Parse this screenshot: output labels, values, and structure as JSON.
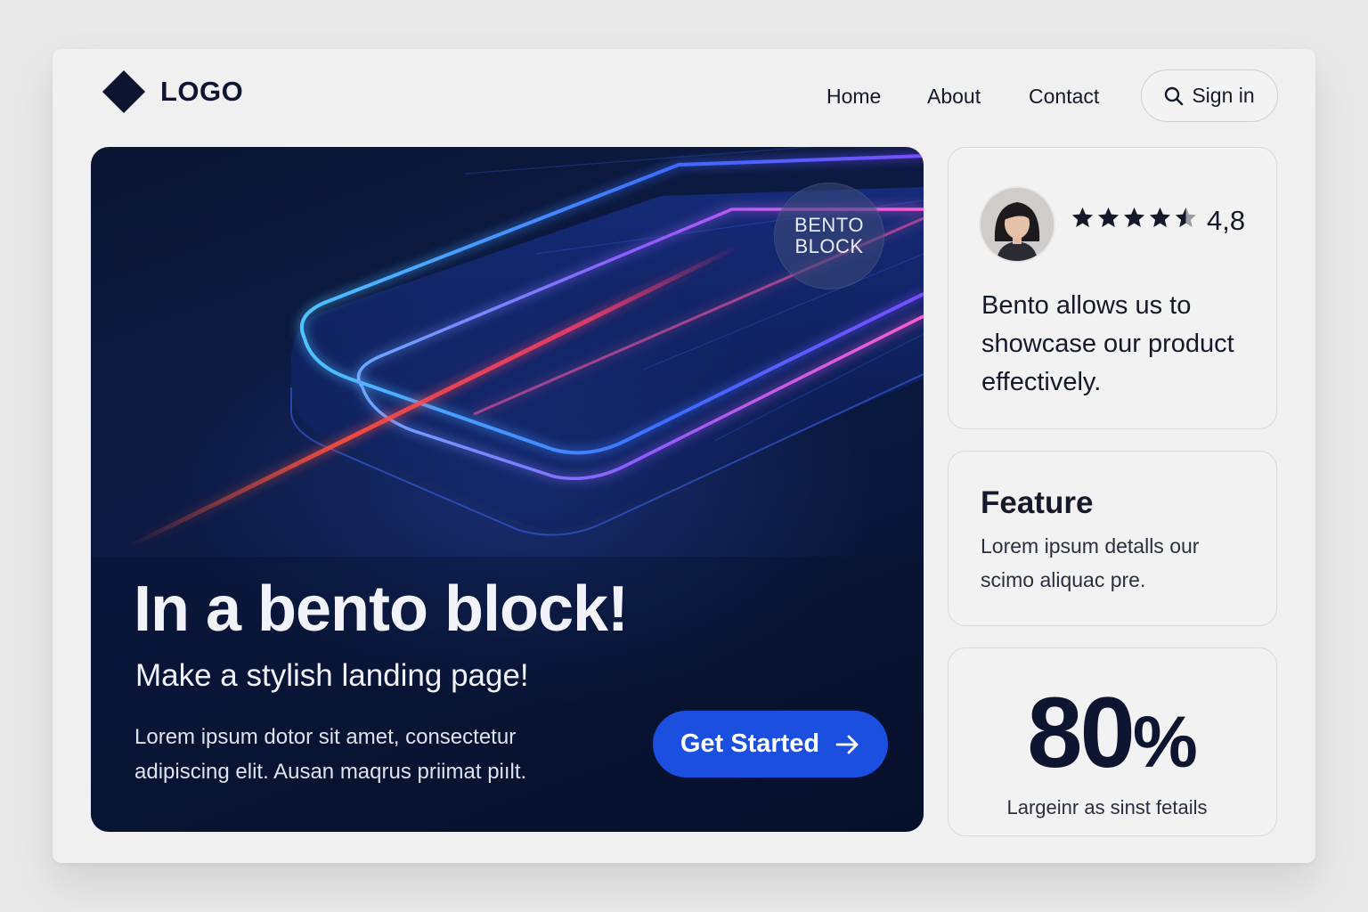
{
  "header": {
    "logo": "LOGO",
    "nav": [
      {
        "label": "Home"
      },
      {
        "label": "About"
      },
      {
        "label": "Contact"
      }
    ],
    "signin": {
      "label": "Sign in",
      "icon": "search-icon"
    }
  },
  "hero": {
    "badge_line1": "BENTO",
    "badge_line2": "BLOCK",
    "title": "In a bento block!",
    "subtitle": "Make a stylish landing page!",
    "body": "Lorem ipsum dotor sit amet, consectetur adipiscing elit. Ausan maqrus priimat piılt.",
    "cta": {
      "label": "Get Started",
      "icon": "arrow-right-icon"
    }
  },
  "review": {
    "rating": "4,8",
    "stars": 4.5,
    "stars_max": 5,
    "quote": "Bento allows us to showcase our product effectively."
  },
  "feature": {
    "title": "Feature",
    "text": "Lorem ipsum  detalls our scimo  aliquac pre."
  },
  "stat": {
    "value": "80",
    "unit": "%",
    "label": "Largeinr as sinst fetails"
  },
  "colors": {
    "accent": "#1a4fe0",
    "navy": "#0e1530",
    "background": "#f0f0f0"
  }
}
